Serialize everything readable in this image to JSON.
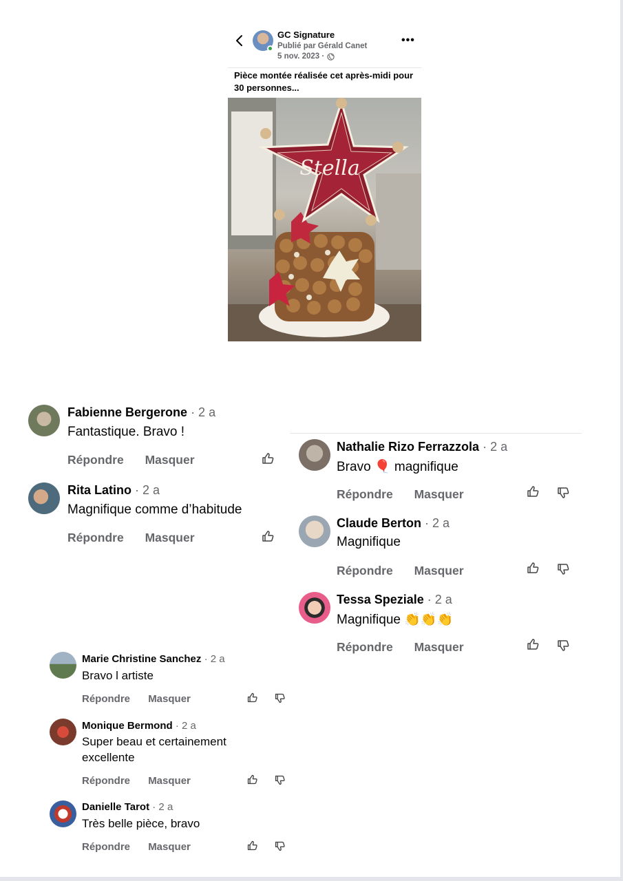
{
  "post": {
    "page_name": "GC Signature",
    "posted_by": "Publié par Gérald Canet",
    "date": "5 nov. 2023 ·",
    "more": "•••",
    "text": "Pièce montée réalisée cet après-midi pour 30 personnes...",
    "photo_text": "Stella"
  },
  "actions": {
    "reply": "Répondre",
    "hide": "Masquer"
  },
  "comments_left": [
    {
      "name": "Fabienne Bergerone",
      "age": "· 2 a",
      "text": "Fantastique. Bravo !"
    },
    {
      "name": "Rita Latino",
      "age": "· 2 a",
      "text": "Magnifique comme d’habitude"
    }
  ],
  "comments_right": [
    {
      "name": "Nathalie Rizo Ferrazzola",
      "age": "· 2 a",
      "text": "Bravo",
      "text_after": "magnifique",
      "emoji": "🎈"
    },
    {
      "name": "Claude Berton",
      "age": "· 2 a",
      "text": "Magnifique"
    },
    {
      "name": "Tessa Speziale",
      "age": "· 2 a",
      "text": "Magnifique",
      "emoji": "👏👏👏"
    }
  ],
  "comments_bottom": [
    {
      "name": "Marie Christine Sanchez",
      "age": "· 2 a",
      "text": "Bravo l artiste"
    },
    {
      "name": "Monique Bermond",
      "age": "· 2 a",
      "text_line1": "Super beau  et certainement",
      "text_line2": "excellente"
    },
    {
      "name": "Danielle Tarot",
      "age": "· 2 a",
      "text": "Très belle pièce, bravo"
    }
  ],
  "colors": {
    "meta": "#65676b",
    "online": "#31a24c",
    "star": "#8c1d2c",
    "divider": "#e4e6eb"
  }
}
